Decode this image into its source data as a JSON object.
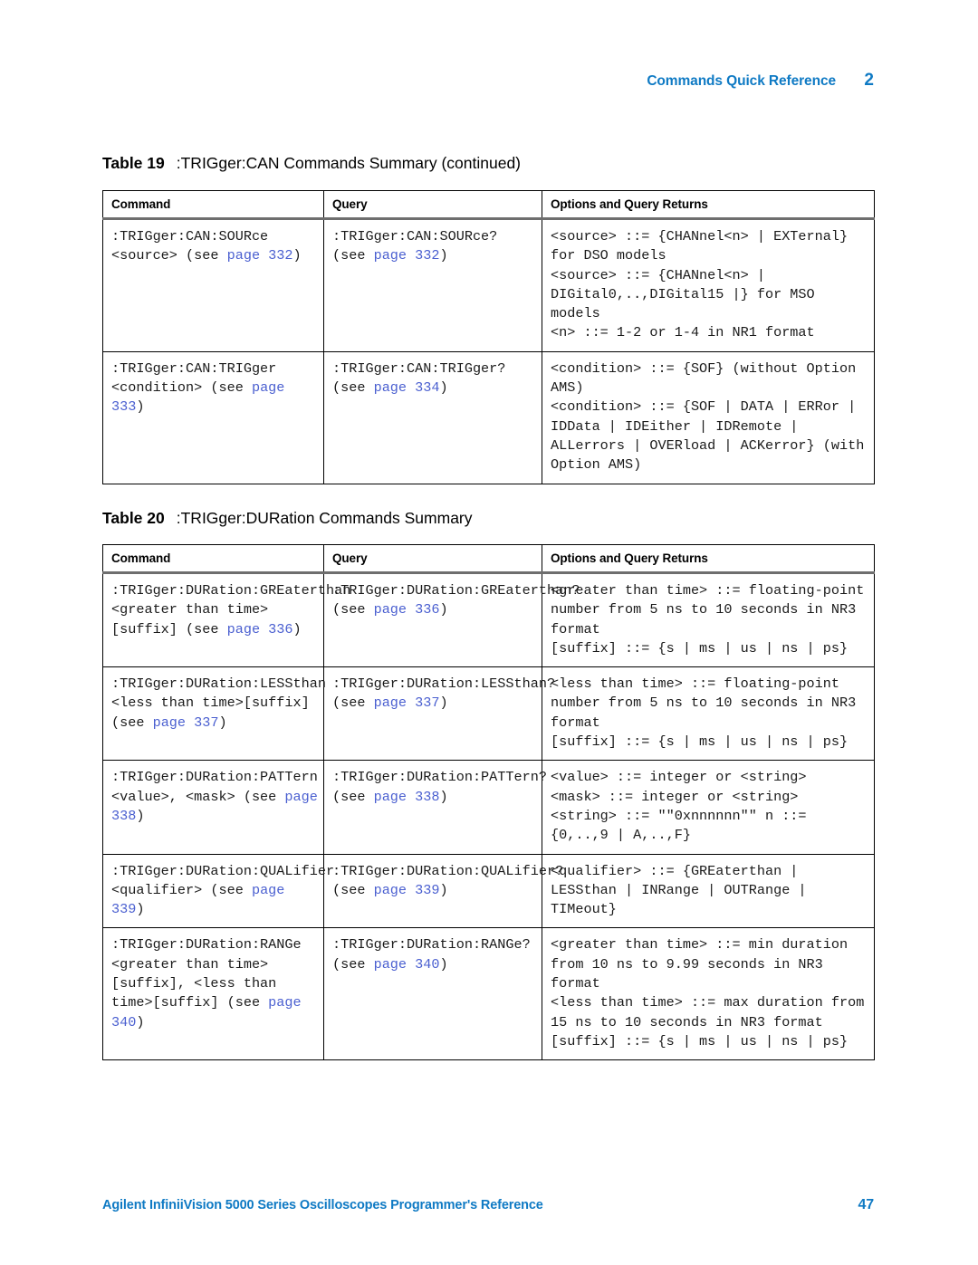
{
  "header": {
    "title": "Commands Quick Reference",
    "chapter": "2"
  },
  "footer": {
    "text": "Agilent InfiniiVision 5000 Series Oscilloscopes Programmer's Reference",
    "page_number": "47"
  },
  "columns": {
    "command": "Command",
    "query": "Query",
    "options": "Options and Query Returns"
  },
  "tables": [
    {
      "caption_number": "Table 19",
      "caption_text": ":TRIGger:CAN Commands Summary (continued)",
      "rows": [
        {
          "command": ":TRIGger:CAN:SOURce <source> (see page 332)",
          "command_links": [
            "page 332"
          ],
          "query": ":TRIGger:CAN:SOURce? (see page 332)",
          "query_links": [
            "page 332"
          ],
          "options": "<source> ::= {CHANnel<n> | EXTernal} for DSO models\n<source> ::= {CHANnel<n> | DIGital0,..,DIGital15 |} for MSO models\n<n> ::= 1-2 or 1-4 in NR1 format"
        },
        {
          "command": ":TRIGger:CAN:TRIGger <condition> (see page 333)",
          "command_links": [
            "page 333"
          ],
          "query": ":TRIGger:CAN:TRIGger? (see page 334)",
          "query_links": [
            "page 334"
          ],
          "options": "<condition> ::= {SOF} (without Option AMS)\n<condition> ::= {SOF | DATA | ERRor | IDData | IDEither | IDRemote | ALLerrors | OVERload | ACKerror} (with Option AMS)"
        }
      ]
    },
    {
      "caption_number": "Table 20",
      "caption_text": ":TRIGger:DURation Commands Summary",
      "rows": [
        {
          "command": ":TRIGger:DURation:GREaterthan <greater than time>[suffix] (see page 336)",
          "command_links": [
            "page 336"
          ],
          "query": ":TRIGger:DURation:GREaterthan? (see page 336)",
          "query_links": [
            "page 336"
          ],
          "options": "<greater than time> ::= floating-point number from 5 ns to 10 seconds in NR3 format\n[suffix] ::= {s | ms | us | ns | ps}"
        },
        {
          "command": ":TRIGger:DURation:LESSthan <less than time>[suffix] (see page 337)",
          "command_links": [
            "page 337"
          ],
          "query": ":TRIGger:DURation:LESSthan? (see page 337)",
          "query_links": [
            "page 337"
          ],
          "options": "<less than time> ::= floating-point number from 5 ns to 10 seconds in NR3 format\n[suffix] ::= {s | ms | us | ns | ps}"
        },
        {
          "command": ":TRIGger:DURation:PATTern <value>, <mask> (see page 338)",
          "command_links": [
            "page 338"
          ],
          "query": ":TRIGger:DURation:PATTern? (see page 338)",
          "query_links": [
            "page 338"
          ],
          "options": "<value> ::= integer or <string>\n<mask> ::= integer or <string>\n<string> ::= \"\"0xnnnnnn\"\" n ::= {0,..,9 | A,..,F}"
        },
        {
          "command": ":TRIGger:DURation:QUALifier <qualifier> (see page 339)",
          "command_links": [
            "page 339"
          ],
          "query": ":TRIGger:DURation:QUALifier? (see page 339)",
          "query_links": [
            "page 339"
          ],
          "options": "<qualifier> ::= {GREaterthan | LESSthan | INRange | OUTRange | TIMeout}"
        },
        {
          "command": ":TRIGger:DURation:RANGe <greater than time>[suffix], <less than time>[suffix] (see page 340)",
          "command_links": [
            "page 340"
          ],
          "query": ":TRIGger:DURation:RANGe? (see page 340)",
          "query_links": [
            "page 340"
          ],
          "options": "<greater than time> ::= min duration from 10 ns to 9.99 seconds in NR3 format\n<less than time> ::= max duration from 15 ns to 10 seconds in NR3 format\n[suffix] ::= {s | ms | us | ns | ps}"
        }
      ]
    }
  ]
}
